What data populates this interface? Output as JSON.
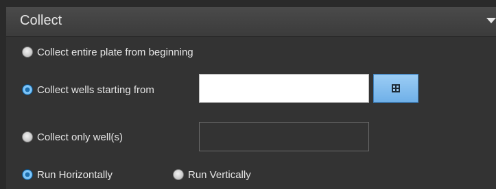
{
  "panel": {
    "title": "Collect"
  },
  "options": {
    "entire_plate": {
      "label": "Collect entire plate from beginning",
      "selected": false
    },
    "starting_from": {
      "label": "Collect wells starting from",
      "selected": true,
      "value": ""
    },
    "only_wells": {
      "label": "Collect only well(s)",
      "selected": false,
      "value": ""
    }
  },
  "direction": {
    "horizontal": {
      "label": "Run Horizontally",
      "selected": true
    },
    "vertical": {
      "label": "Run Vertically",
      "selected": false
    }
  },
  "icons": {
    "collapse": "chevron-down-icon",
    "well_picker": "grid-icon"
  },
  "colors": {
    "panel_bg": "#333333",
    "accent": "#6fb0e8"
  }
}
